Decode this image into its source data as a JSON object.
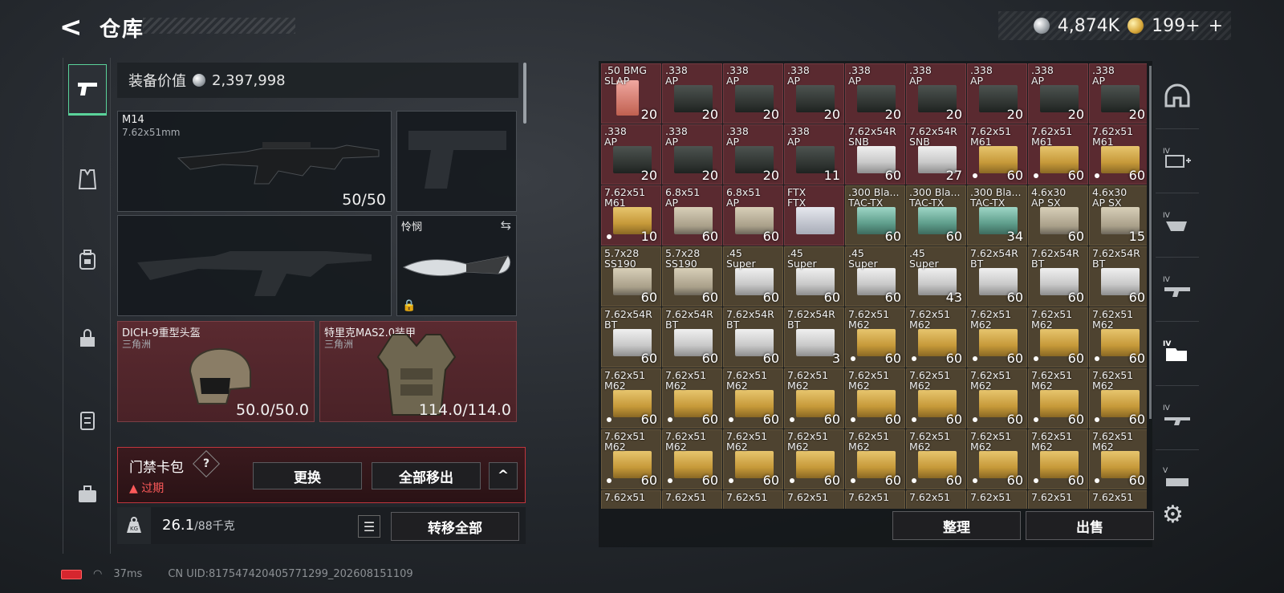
{
  "header": {
    "back": "<",
    "title": "仓库"
  },
  "currency": {
    "silver": "4,874K",
    "gold": "199+"
  },
  "left_tabs": [
    "pistol-icon",
    "armor-vest-icon",
    "backpack-icon",
    "bag-icon",
    "chest-rig-icon",
    "briefcase-icon"
  ],
  "loadout": {
    "value_label": "装备价值",
    "value": "2,397,998",
    "primary": {
      "name": "M14",
      "caliber": "7.62x51mm",
      "ammo": "50/50"
    },
    "melee": {
      "name": "怜悯"
    },
    "helmet": {
      "name": "DICH-9重型头盔",
      "sub": "三角洲",
      "durability": "50.0/50.0"
    },
    "armor": {
      "name": "特里克MAS2.0装甲",
      "sub": "三角洲",
      "durability": "114.0/114.0"
    }
  },
  "keycard": {
    "title": "门禁卡包",
    "help": "?",
    "status": "过期",
    "replace": "更换",
    "remove_all": "全部移出",
    "collapse": "^"
  },
  "weight": {
    "icon": "KG",
    "current": "26.1",
    "max": "/88千克",
    "transfer_all": "转移全部"
  },
  "status_bar": {
    "ping": "37ms",
    "uid": "CN UID:817547420405771299_202608151109"
  },
  "stash": {
    "sort_label": "整理",
    "sell_label": "出售",
    "items": [
      {
        "l1": ".50 BMG",
        "l2": "SLAP",
        "count": "20",
        "bg": "red",
        "box": "pink",
        "dot": false
      },
      {
        "l1": ".338",
        "l2": "AP",
        "count": "20",
        "bg": "red",
        "box": "dark",
        "dot": false
      },
      {
        "l1": ".338",
        "l2": "AP",
        "count": "20",
        "bg": "red",
        "box": "dark",
        "dot": false
      },
      {
        "l1": ".338",
        "l2": "AP",
        "count": "20",
        "bg": "red",
        "box": "dark",
        "dot": false
      },
      {
        "l1": ".338",
        "l2": "AP",
        "count": "20",
        "bg": "red",
        "box": "dark",
        "dot": false
      },
      {
        "l1": ".338",
        "l2": "AP",
        "count": "20",
        "bg": "red",
        "box": "dark",
        "dot": false
      },
      {
        "l1": ".338",
        "l2": "AP",
        "count": "20",
        "bg": "red",
        "box": "dark",
        "dot": false
      },
      {
        "l1": ".338",
        "l2": "AP",
        "count": "20",
        "bg": "red",
        "box": "dark",
        "dot": false
      },
      {
        "l1": ".338",
        "l2": "AP",
        "count": "20",
        "bg": "red",
        "box": "dark",
        "dot": false
      },
      {
        "l1": ".338",
        "l2": "AP",
        "count": "20",
        "bg": "red",
        "box": "dark",
        "dot": false
      },
      {
        "l1": ".338",
        "l2": "AP",
        "count": "20",
        "bg": "red",
        "box": "dark",
        "dot": false
      },
      {
        "l1": ".338",
        "l2": "AP",
        "count": "20",
        "bg": "red",
        "box": "dark",
        "dot": false
      },
      {
        "l1": ".338",
        "l2": "AP",
        "count": "11",
        "bg": "red",
        "box": "dark",
        "dot": false
      },
      {
        "l1": "7.62x54R",
        "l2": "SNB",
        "count": "60",
        "bg": "red",
        "box": "white",
        "dot": false
      },
      {
        "l1": "7.62x54R",
        "l2": "SNB",
        "count": "27",
        "bg": "red",
        "box": "white",
        "dot": false
      },
      {
        "l1": "7.62x51",
        "l2": "M61",
        "count": "60",
        "bg": "red",
        "box": "yellow",
        "dot": true
      },
      {
        "l1": "7.62x51",
        "l2": "M61",
        "count": "60",
        "bg": "red",
        "box": "yellow",
        "dot": true
      },
      {
        "l1": "7.62x51",
        "l2": "M61",
        "count": "60",
        "bg": "red",
        "box": "yellow",
        "dot": true
      },
      {
        "l1": "7.62x51",
        "l2": "M61",
        "count": "10",
        "bg": "red",
        "box": "yellow",
        "dot": true
      },
      {
        "l1": "6.8x51",
        "l2": "AP",
        "count": "60",
        "bg": "red",
        "box": "beige",
        "dot": false
      },
      {
        "l1": "6.8x51",
        "l2": "AP",
        "count": "60",
        "bg": "red",
        "box": "beige",
        "dot": false
      },
      {
        "l1": "FTX",
        "l2": "FTX",
        "count": "",
        "bg": "red",
        "box": "silver",
        "dot": false
      },
      {
        "l1": ".300 Bla...",
        "l2": "TAC-TX",
        "count": "60",
        "bg": "gold",
        "box": "teal",
        "dot": false
      },
      {
        "l1": ".300 Bla...",
        "l2": "TAC-TX",
        "count": "60",
        "bg": "gold",
        "box": "teal",
        "dot": false
      },
      {
        "l1": ".300 Bla...",
        "l2": "TAC-TX",
        "count": "34",
        "bg": "gold",
        "box": "teal",
        "dot": false
      },
      {
        "l1": "4.6x30",
        "l2": "AP SX",
        "count": "60",
        "bg": "gold",
        "box": "beige",
        "dot": false
      },
      {
        "l1": "4.6x30",
        "l2": "AP SX",
        "count": "15",
        "bg": "gold",
        "box": "beige",
        "dot": false
      },
      {
        "l1": "5.7x28",
        "l2": "SS190",
        "count": "60",
        "bg": "gold",
        "box": "beige",
        "dot": false
      },
      {
        "l1": "5.7x28",
        "l2": "SS190",
        "count": "60",
        "bg": "gold",
        "box": "beige",
        "dot": false
      },
      {
        "l1": ".45",
        "l2": "Super",
        "count": "60",
        "bg": "gold",
        "box": "white",
        "dot": false
      },
      {
        "l1": ".45",
        "l2": "Super",
        "count": "60",
        "bg": "gold",
        "box": "white",
        "dot": false
      },
      {
        "l1": ".45",
        "l2": "Super",
        "count": "60",
        "bg": "gold",
        "box": "white",
        "dot": false
      },
      {
        "l1": ".45",
        "l2": "Super",
        "count": "43",
        "bg": "gold",
        "box": "white",
        "dot": false
      },
      {
        "l1": "7.62x54R",
        "l2": "BT",
        "count": "60",
        "bg": "gold",
        "box": "white",
        "dot": false
      },
      {
        "l1": "7.62x54R",
        "l2": "BT",
        "count": "60",
        "bg": "gold",
        "box": "white",
        "dot": false
      },
      {
        "l1": "7.62x54R",
        "l2": "BT",
        "count": "60",
        "bg": "gold",
        "box": "white",
        "dot": false
      },
      {
        "l1": "7.62x54R",
        "l2": "BT",
        "count": "60",
        "bg": "gold",
        "box": "white",
        "dot": false
      },
      {
        "l1": "7.62x54R",
        "l2": "BT",
        "count": "60",
        "bg": "gold",
        "box": "white",
        "dot": false
      },
      {
        "l1": "7.62x54R",
        "l2": "BT",
        "count": "60",
        "bg": "gold",
        "box": "white",
        "dot": false
      },
      {
        "l1": "7.62x54R",
        "l2": "BT",
        "count": "3",
        "bg": "gold",
        "box": "white",
        "dot": false
      },
      {
        "l1": "7.62x51",
        "l2": "M62",
        "count": "60",
        "bg": "gold",
        "box": "yellow",
        "dot": true
      },
      {
        "l1": "7.62x51",
        "l2": "M62",
        "count": "60",
        "bg": "gold",
        "box": "yellow",
        "dot": true
      },
      {
        "l1": "7.62x51",
        "l2": "M62",
        "count": "60",
        "bg": "gold",
        "box": "yellow",
        "dot": true
      },
      {
        "l1": "7.62x51",
        "l2": "M62",
        "count": "60",
        "bg": "gold",
        "box": "yellow",
        "dot": true
      },
      {
        "l1": "7.62x51",
        "l2": "M62",
        "count": "60",
        "bg": "gold",
        "box": "yellow",
        "dot": true
      },
      {
        "l1": "7.62x51",
        "l2": "M62",
        "count": "60",
        "bg": "gold",
        "box": "yellow",
        "dot": true
      },
      {
        "l1": "7.62x51",
        "l2": "M62",
        "count": "60",
        "bg": "gold",
        "box": "yellow",
        "dot": true
      },
      {
        "l1": "7.62x51",
        "l2": "M62",
        "count": "60",
        "bg": "gold",
        "box": "yellow",
        "dot": true
      },
      {
        "l1": "7.62x51",
        "l2": "M62",
        "count": "60",
        "bg": "gold",
        "box": "yellow",
        "dot": true
      },
      {
        "l1": "7.62x51",
        "l2": "M62",
        "count": "60",
        "bg": "gold",
        "box": "yellow",
        "dot": true
      },
      {
        "l1": "7.62x51",
        "l2": "M62",
        "count": "60",
        "bg": "gold",
        "box": "yellow",
        "dot": true
      },
      {
        "l1": "7.62x51",
        "l2": "M62",
        "count": "60",
        "bg": "gold",
        "box": "yellow",
        "dot": true
      },
      {
        "l1": "7.62x51",
        "l2": "M62",
        "count": "60",
        "bg": "gold",
        "box": "yellow",
        "dot": true
      },
      {
        "l1": "7.62x51",
        "l2": "M62",
        "count": "60",
        "bg": "gold",
        "box": "yellow",
        "dot": true
      },
      {
        "l1": "7.62x51",
        "l2": "M62",
        "count": "60",
        "bg": "gold",
        "box": "yellow",
        "dot": true
      },
      {
        "l1": "7.62x51",
        "l2": "M62",
        "count": "60",
        "bg": "gold",
        "box": "yellow",
        "dot": true
      },
      {
        "l1": "7.62x51",
        "l2": "M62",
        "count": "60",
        "bg": "gold",
        "box": "yellow",
        "dot": true
      },
      {
        "l1": "7.62x51",
        "l2": "M62",
        "count": "60",
        "bg": "gold",
        "box": "yellow",
        "dot": true
      },
      {
        "l1": "7.62x51",
        "l2": "M62",
        "count": "60",
        "bg": "gold",
        "box": "yellow",
        "dot": true
      },
      {
        "l1": "7.62x51",
        "l2": "M62",
        "count": "60",
        "bg": "gold",
        "box": "yellow",
        "dot": true
      },
      {
        "l1": "7.62x51",
        "l2": "M62",
        "count": "60",
        "bg": "gold",
        "box": "yellow",
        "dot": true
      },
      {
        "l1": "7.62x51",
        "l2": "M62",
        "count": "60",
        "bg": "gold",
        "box": "yellow",
        "dot": true
      },
      {
        "l1": "7.62x51",
        "l2": "M62",
        "count": "60",
        "bg": "gold",
        "box": "yellow",
        "dot": true
      },
      {
        "l1": "7.62x51",
        "l2": "",
        "count": "",
        "bg": "gold",
        "box": "yellow",
        "dot": false
      },
      {
        "l1": "7.62x51",
        "l2": "",
        "count": "",
        "bg": "gold",
        "box": "yellow",
        "dot": false
      },
      {
        "l1": "7.62x51",
        "l2": "",
        "count": "",
        "bg": "gold",
        "box": "yellow",
        "dot": false
      },
      {
        "l1": "7.62x51",
        "l2": "",
        "count": "",
        "bg": "gold",
        "box": "yellow",
        "dot": false
      },
      {
        "l1": "7.62x51",
        "l2": "",
        "count": "",
        "bg": "gold",
        "box": "yellow",
        "dot": false
      },
      {
        "l1": "7.62x51",
        "l2": "",
        "count": "",
        "bg": "gold",
        "box": "yellow",
        "dot": false
      },
      {
        "l1": "7.62x51",
        "l2": "",
        "count": "",
        "bg": "gold",
        "box": "yellow",
        "dot": false
      },
      {
        "l1": "7.62x51",
        "l2": "",
        "count": "",
        "bg": "gold",
        "box": "yellow",
        "dot": false
      },
      {
        "l1": "7.62x51",
        "l2": "",
        "count": "",
        "bg": "gold",
        "box": "yellow",
        "dot": false
      }
    ]
  },
  "right_tabs": [
    "helmet-filter-icon",
    "medkit-filter-icon",
    "gear-filter-icon",
    "weapon-filter-icon",
    "ammo-filter-icon",
    "rifle-filter-icon",
    "misc-filter-icon"
  ],
  "colors": {
    "accent_green": "#5ad29a",
    "expired_red": "#ff5a5a",
    "red_item_bg": "#5a2a30",
    "gold_item_bg": "#4e4330"
  }
}
